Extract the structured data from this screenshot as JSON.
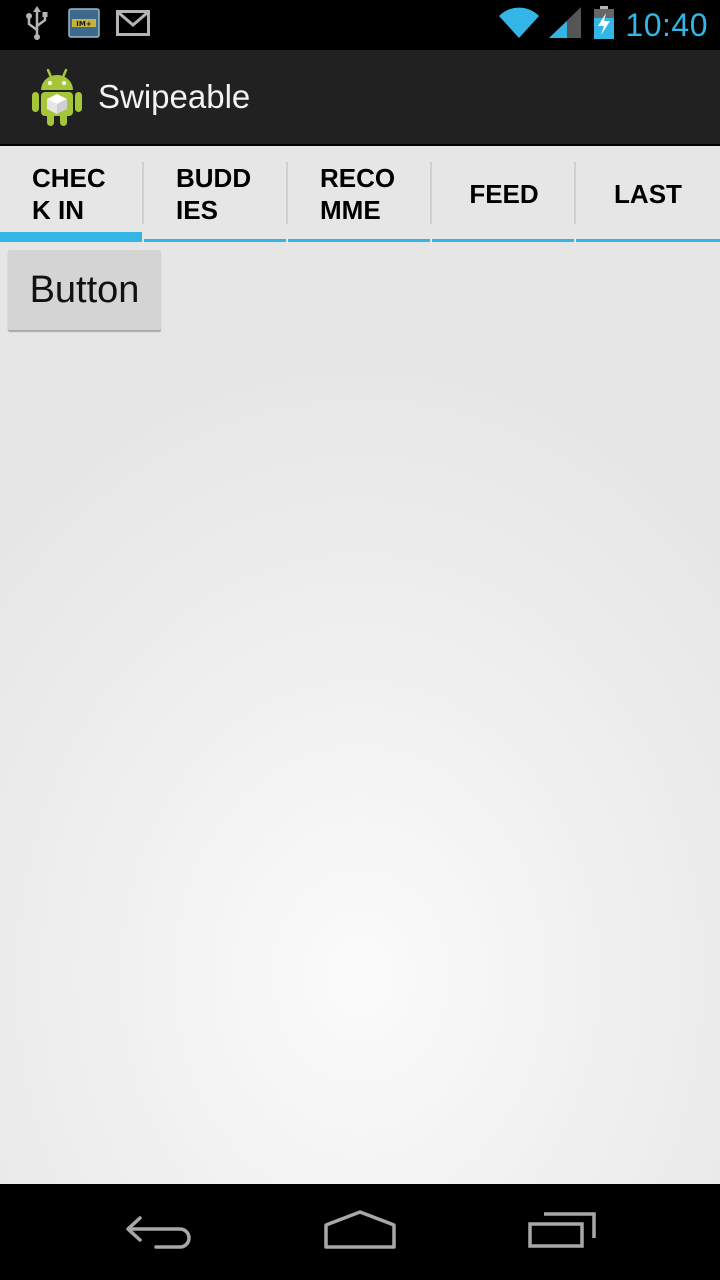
{
  "status_bar": {
    "time": "10:40",
    "icons": [
      "usb-icon",
      "im-notification-icon",
      "gmail-icon",
      "wifi-icon",
      "cell-signal-icon",
      "battery-charging-icon"
    ],
    "accent_color": "#33b5e5"
  },
  "action_bar": {
    "title": "Swipeable",
    "icon": "android-app-icon",
    "background": "#212121"
  },
  "tabs": [
    {
      "label": "CHECK IN",
      "selected": true
    },
    {
      "label": "BUDDIES",
      "selected": false
    },
    {
      "label": "RECOMME",
      "selected": false
    },
    {
      "label": "FEED",
      "selected": false
    },
    {
      "label": "LAST",
      "selected": false
    }
  ],
  "tab_indicator_color": "#33b5e5",
  "content": {
    "button_label": "Button"
  },
  "nav_bar": {
    "buttons": [
      "back-icon",
      "home-icon",
      "recent-apps-icon"
    ]
  }
}
